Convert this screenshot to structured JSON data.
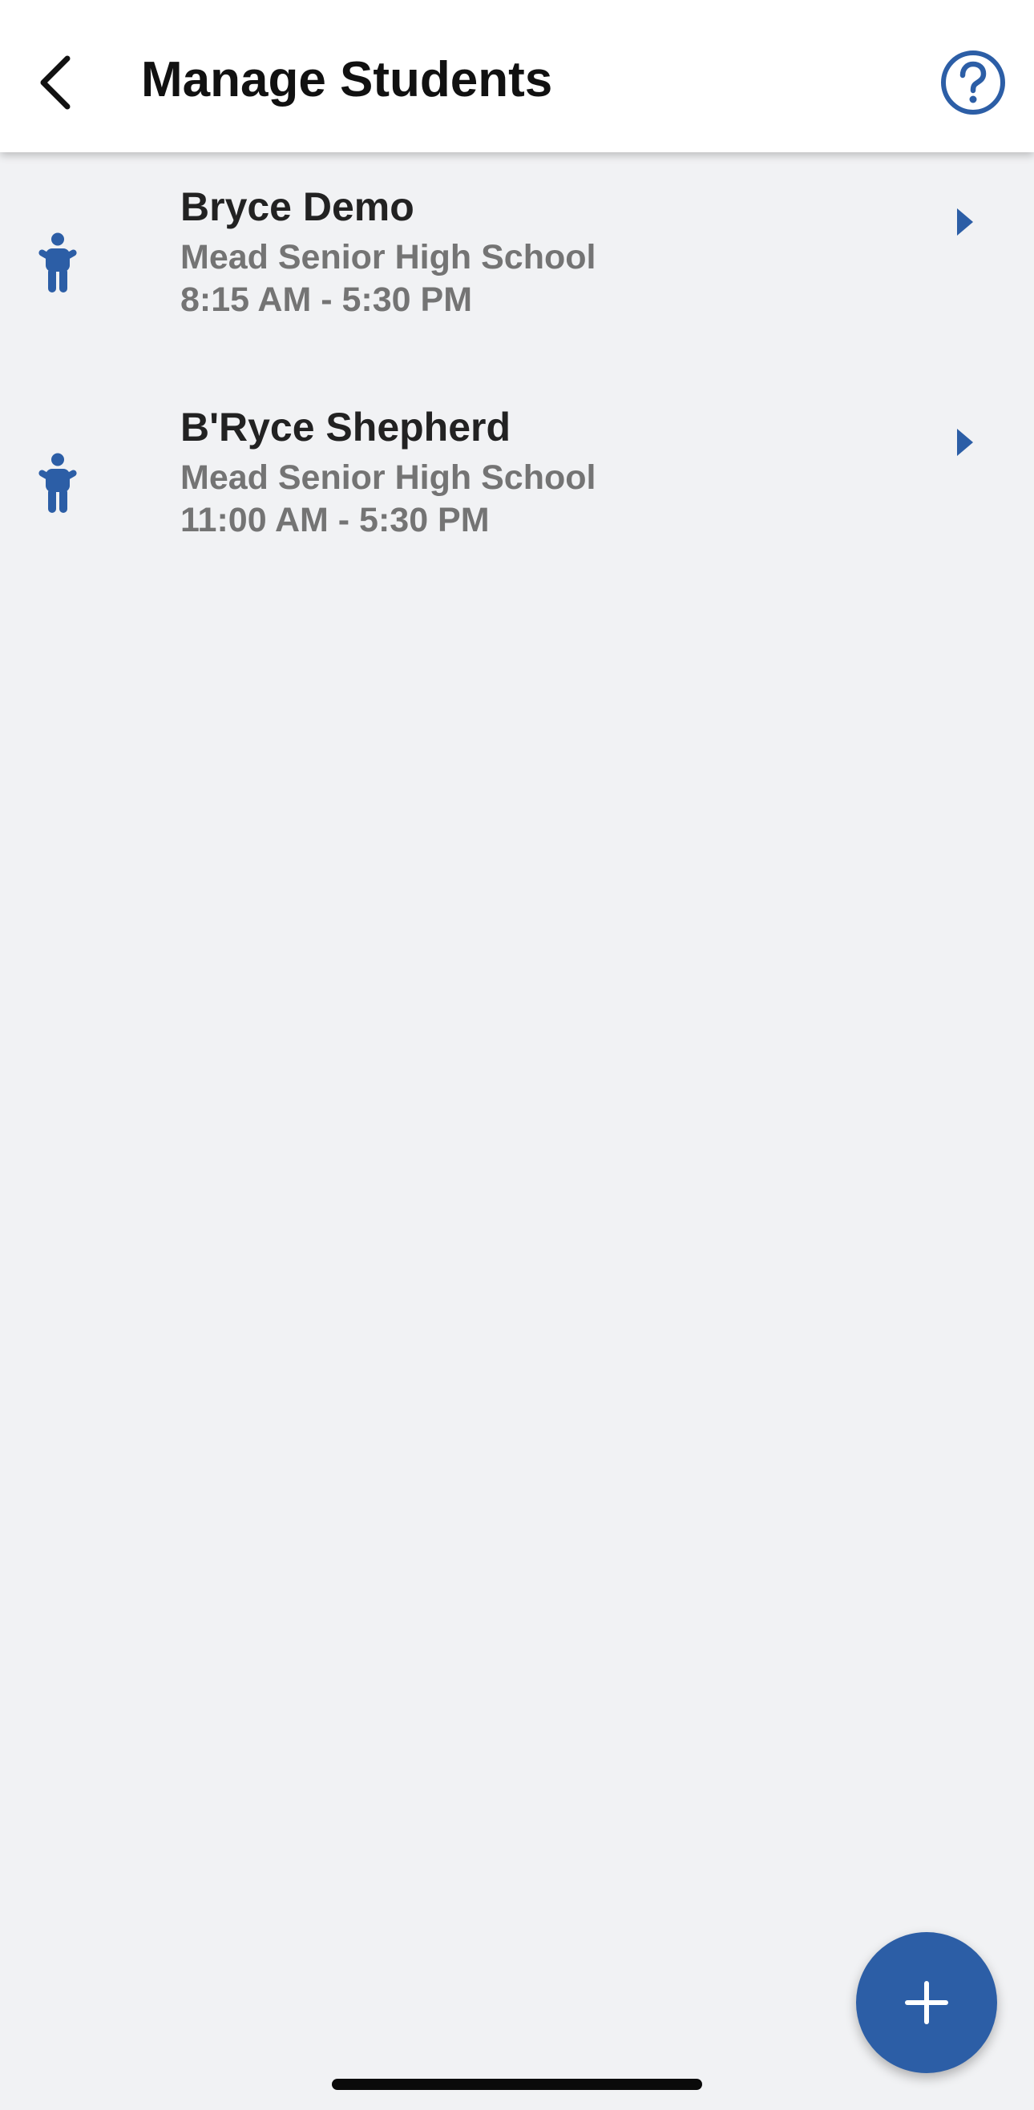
{
  "header": {
    "title": "Manage Students",
    "back_icon": "chevron-left-icon",
    "help_icon": "question-circle-icon"
  },
  "students": [
    {
      "name": "Bryce Demo",
      "school": "Mead Senior High School",
      "hours": "8:15 AM - 5:30 PM"
    },
    {
      "name": "B'Ryce Shepherd",
      "school": "Mead Senior High School",
      "hours": "11:00 AM - 5:30 PM"
    }
  ],
  "fab": {
    "icon": "plus-icon"
  },
  "colors": {
    "accent": "#2c5ea6",
    "background": "#f1f2f4",
    "header_background": "#ffffff",
    "name_text": "#222222",
    "secondary_text": "#747474"
  }
}
